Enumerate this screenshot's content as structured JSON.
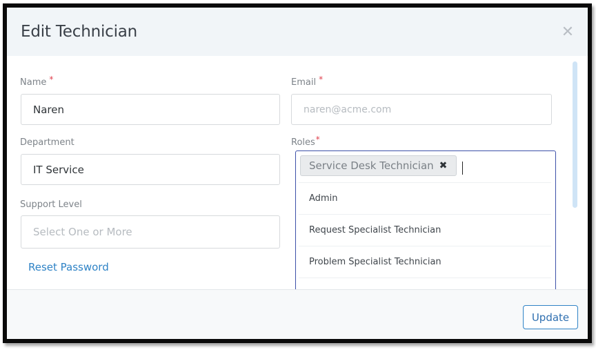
{
  "dialog": {
    "title": "Edit Technician",
    "close_icon": "close-icon"
  },
  "form": {
    "name": {
      "label": "Name",
      "required_mark": "*",
      "value": "Naren"
    },
    "email": {
      "label": "Email",
      "required_mark": "*",
      "placeholder": "naren@acme.com"
    },
    "department": {
      "label": "Department",
      "value": "IT Service"
    },
    "roles": {
      "label": "Roles",
      "required_mark": "*",
      "selected": [
        {
          "label": "Service Desk Technician",
          "remove_icon": "close-icon"
        }
      ],
      "options": [
        "Admin",
        "Request Specialist Technician",
        "Problem Specialist Technician"
      ]
    },
    "support_level": {
      "label": "Support Level",
      "placeholder": "Select One or More"
    },
    "reset_password_link": "Reset Password"
  },
  "footer": {
    "update_label": "Update"
  },
  "colors": {
    "accent": "#2f83c6",
    "required": "#e0414e",
    "focus_border": "#3c4fa8"
  }
}
